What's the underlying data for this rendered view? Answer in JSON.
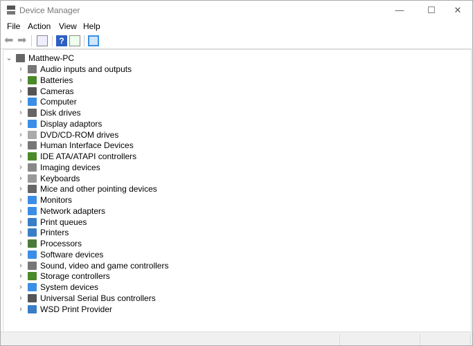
{
  "window": {
    "title": "Device Manager",
    "minimize": "—",
    "maximize": "☐",
    "close": "✕"
  },
  "menu": [
    "File",
    "Action",
    "View",
    "Help"
  ],
  "toolbar": [
    "back-icon",
    "forward-icon",
    "properties-icon",
    "help-icon",
    "update-driver-icon",
    "scan-hardware-icon"
  ],
  "tree": {
    "root": "Matthew-PC",
    "items": [
      {
        "label": "Audio inputs and outputs",
        "color": "#777"
      },
      {
        "label": "Batteries",
        "color": "#4a8a2a"
      },
      {
        "label": "Cameras",
        "color": "#555"
      },
      {
        "label": "Computer",
        "color": "#3a8ee6"
      },
      {
        "label": "Disk drives",
        "color": "#666"
      },
      {
        "label": "Display adaptors",
        "color": "#3a8ee6"
      },
      {
        "label": "DVD/CD-ROM drives",
        "color": "#aaa"
      },
      {
        "label": "Human Interface Devices",
        "color": "#777"
      },
      {
        "label": "IDE ATA/ATAPI controllers",
        "color": "#4a8a2a"
      },
      {
        "label": "Imaging devices",
        "color": "#888"
      },
      {
        "label": "Keyboards",
        "color": "#999"
      },
      {
        "label": "Mice and other pointing devices",
        "color": "#666"
      },
      {
        "label": "Monitors",
        "color": "#3a8ee6"
      },
      {
        "label": "Network adapters",
        "color": "#3a8ee6"
      },
      {
        "label": "Print queues",
        "color": "#3a7ec6"
      },
      {
        "label": "Printers",
        "color": "#3a7ec6"
      },
      {
        "label": "Processors",
        "color": "#4a7a3a"
      },
      {
        "label": "Software devices",
        "color": "#3a8ee6"
      },
      {
        "label": "Sound, video and game controllers",
        "color": "#777"
      },
      {
        "label": "Storage controllers",
        "color": "#4a8a2a"
      },
      {
        "label": "System devices",
        "color": "#3a8ee6"
      },
      {
        "label": "Universal Serial Bus controllers",
        "color": "#555"
      },
      {
        "label": "WSD Print Provider",
        "color": "#3a7ec6"
      }
    ]
  }
}
